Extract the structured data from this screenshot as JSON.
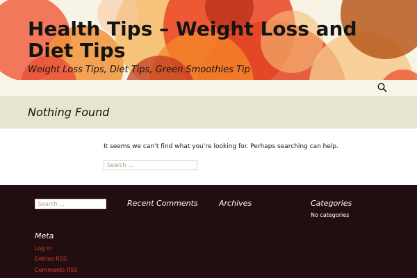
{
  "site": {
    "title": "Health Tips – Weight Loss and Diet Tips",
    "description": "Weight Loss Tips, Diet Tips, Green Smoothies Tip"
  },
  "header": {
    "icons": [
      "search-icon"
    ]
  },
  "page": {
    "title": "Nothing Found",
    "message": "It seems we can’t find what you’re looking for. Perhaps searching can help.",
    "search_placeholder": "Search …"
  },
  "footer": {
    "search_placeholder": "Search …",
    "widgets": {
      "recent_comments": {
        "title": "Recent Comments"
      },
      "archives": {
        "title": "Archives"
      },
      "categories": {
        "title": "Categories",
        "empty_text": "No categories"
      },
      "meta": {
        "title": "Meta",
        "links": [
          "Log in",
          "Entries RSS",
          "Comments RSS"
        ]
      }
    }
  },
  "colors": {
    "header_bg": "#f7f3e6",
    "nav_bg": "#f7f5e7",
    "page_header_bg": "#e8e5ce",
    "footer_bg": "#220e10",
    "link": "#e63f2a",
    "text": "#141412"
  }
}
